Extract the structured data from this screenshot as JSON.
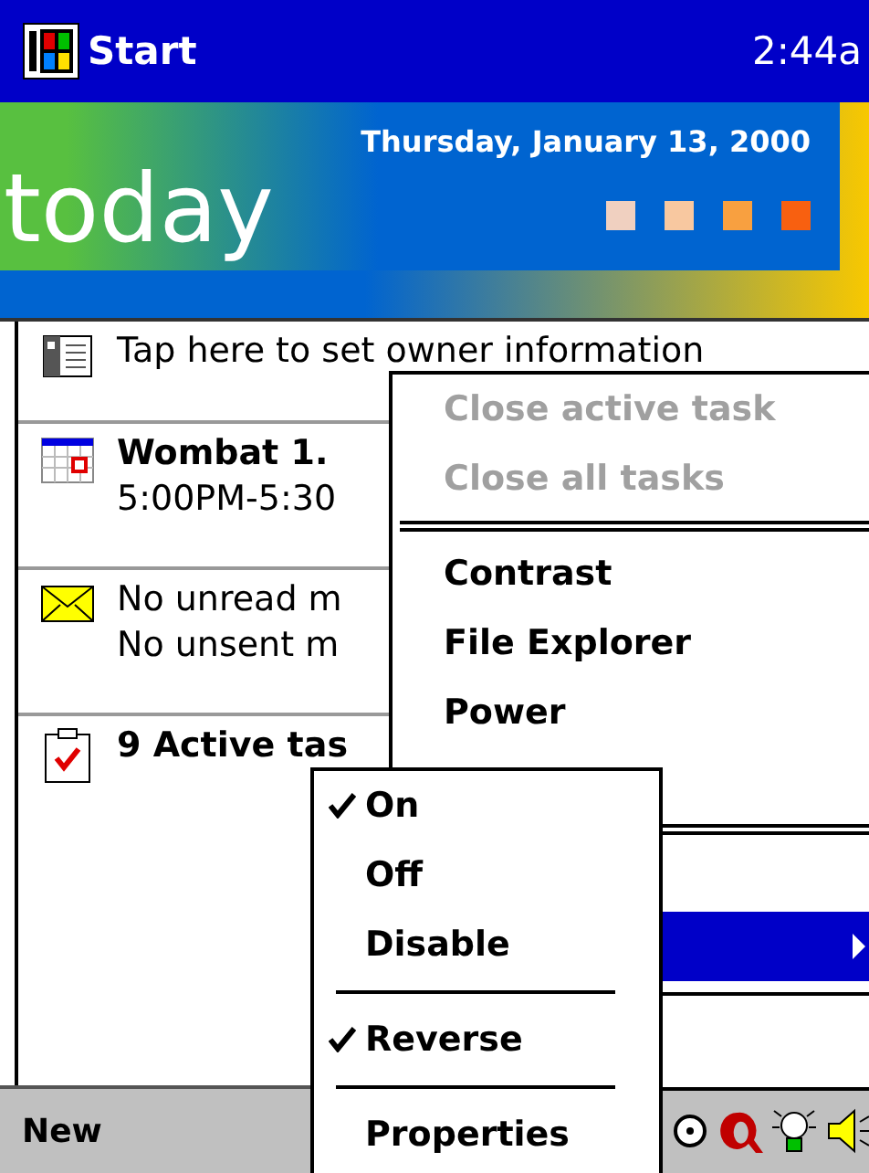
{
  "title_bar": {
    "title": "Start",
    "time": "2:44a"
  },
  "banner": {
    "date": "Thursday, January 13, 2000",
    "heading": "today",
    "squares": [
      {
        "color": "#f0d0c0"
      },
      {
        "color": "#f8c8a0"
      },
      {
        "color": "#f8a040"
      },
      {
        "color": "#f86010"
      }
    ]
  },
  "today_items": [
    {
      "kind": "owner",
      "lines": [
        {
          "text": "Tap here to set owner information",
          "bold": false
        }
      ]
    },
    {
      "kind": "calendar",
      "lines": [
        {
          "text": "Wombat 1.",
          "bold": true
        },
        {
          "text": "5:00PM-5:30",
          "bold": false
        }
      ]
    },
    {
      "kind": "mail",
      "lines": [
        {
          "text": "No unread m",
          "bold": false
        },
        {
          "text": "No unsent m",
          "bold": false
        }
      ]
    },
    {
      "kind": "tasks",
      "lines": [
        {
          "text": "9 Active tas",
          "bold": true
        }
      ]
    }
  ],
  "main_menu": {
    "items": [
      {
        "kind": "item",
        "label": "Close active task",
        "disabled": true
      },
      {
        "kind": "item",
        "label": "Close all tasks",
        "disabled": true
      },
      {
        "kind": "double_separator"
      },
      {
        "kind": "item",
        "label": "Contrast",
        "disabled": false
      },
      {
        "kind": "item",
        "label": "File Explorer",
        "disabled": false
      },
      {
        "kind": "item",
        "label": "Power",
        "disabled": false
      },
      {
        "kind": "covered"
      },
      {
        "kind": "double_separator"
      },
      {
        "kind": "covered"
      },
      {
        "kind": "submenu",
        "selected": true
      },
      {
        "kind": "separator"
      },
      {
        "kind": "covered"
      }
    ]
  },
  "submenu": {
    "items": [
      {
        "kind": "item",
        "label": "On",
        "checked": true
      },
      {
        "kind": "item",
        "label": "Off",
        "checked": false
      },
      {
        "kind": "item",
        "label": "Disable",
        "checked": false
      },
      {
        "kind": "separator"
      },
      {
        "kind": "item",
        "label": "Reverse",
        "checked": true
      },
      {
        "kind": "separator"
      },
      {
        "kind": "item",
        "label": "Properties",
        "checked": false
      }
    ]
  },
  "command_bar": {
    "new_label": "New"
  }
}
